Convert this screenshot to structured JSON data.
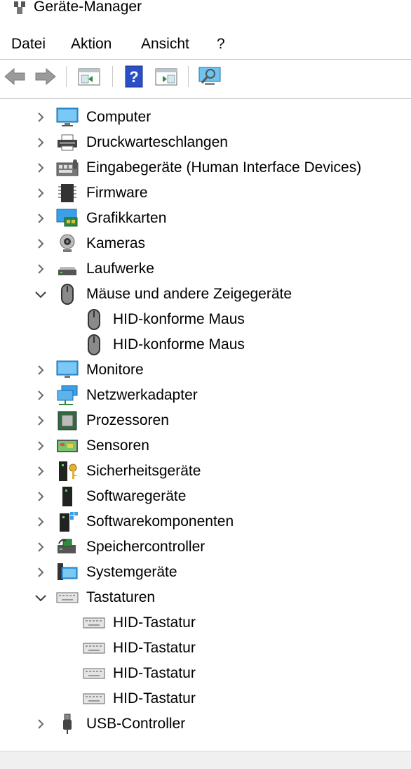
{
  "window": {
    "title": "Geräte-Manager"
  },
  "menubar": {
    "items": [
      "Datei",
      "Aktion",
      "Ansicht",
      "?"
    ]
  },
  "toolbar": {
    "buttons": [
      "back-icon",
      "forward-icon",
      "show-hide-console-tree-icon",
      "help-icon",
      "action-pane-icon",
      "scan-hardware-icon"
    ]
  },
  "tree": {
    "items": [
      {
        "label": "Computer",
        "expanded": false,
        "icon": "computer-icon"
      },
      {
        "label": "Druckwarteschlangen",
        "expanded": false,
        "icon": "printer-icon"
      },
      {
        "label": "Eingabegeräte (Human Interface Devices)",
        "expanded": false,
        "icon": "hid-icon"
      },
      {
        "label": "Firmware",
        "expanded": false,
        "icon": "firmware-icon"
      },
      {
        "label": "Grafikkarten",
        "expanded": false,
        "icon": "display-adapter-icon"
      },
      {
        "label": "Kameras",
        "expanded": false,
        "icon": "camera-icon"
      },
      {
        "label": "Laufwerke",
        "expanded": false,
        "icon": "drive-icon"
      },
      {
        "label": "Mäuse und andere Zeigegeräte",
        "expanded": true,
        "icon": "mouse-icon"
      },
      {
        "label": "HID-konforme Maus",
        "child": true,
        "icon": "mouse-icon"
      },
      {
        "label": "HID-konforme Maus",
        "child": true,
        "icon": "mouse-icon"
      },
      {
        "label": "Monitore",
        "expanded": false,
        "icon": "monitor-icon"
      },
      {
        "label": "Netzwerkadapter",
        "expanded": false,
        "icon": "network-adapter-icon"
      },
      {
        "label": "Prozessoren",
        "expanded": false,
        "icon": "processor-icon"
      },
      {
        "label": "Sensoren",
        "expanded": false,
        "icon": "sensor-icon"
      },
      {
        "label": "Sicherheitsgeräte",
        "expanded": false,
        "icon": "security-device-icon"
      },
      {
        "label": "Softwaregeräte",
        "expanded": false,
        "icon": "software-device-icon"
      },
      {
        "label": "Softwarekomponenten",
        "expanded": false,
        "icon": "software-component-icon"
      },
      {
        "label": "Speichercontroller",
        "expanded": false,
        "icon": "storage-controller-icon"
      },
      {
        "label": "Systemgeräte",
        "expanded": false,
        "icon": "system-device-icon"
      },
      {
        "label": "Tastaturen",
        "expanded": true,
        "icon": "keyboard-icon"
      },
      {
        "label": "HID-Tastatur",
        "child": true,
        "icon": "keyboard-icon"
      },
      {
        "label": "HID-Tastatur",
        "child": true,
        "icon": "keyboard-icon"
      },
      {
        "label": "HID-Tastatur",
        "child": true,
        "icon": "keyboard-icon"
      },
      {
        "label": "HID-Tastatur",
        "child": true,
        "icon": "keyboard-icon"
      },
      {
        "label": "USB-Controller",
        "expanded": false,
        "icon": "usb-icon"
      }
    ]
  },
  "colors": {
    "accent_blue": "#1e90e0",
    "chip_green": "#2e8b3d",
    "chevron": "#6a6a6a"
  }
}
